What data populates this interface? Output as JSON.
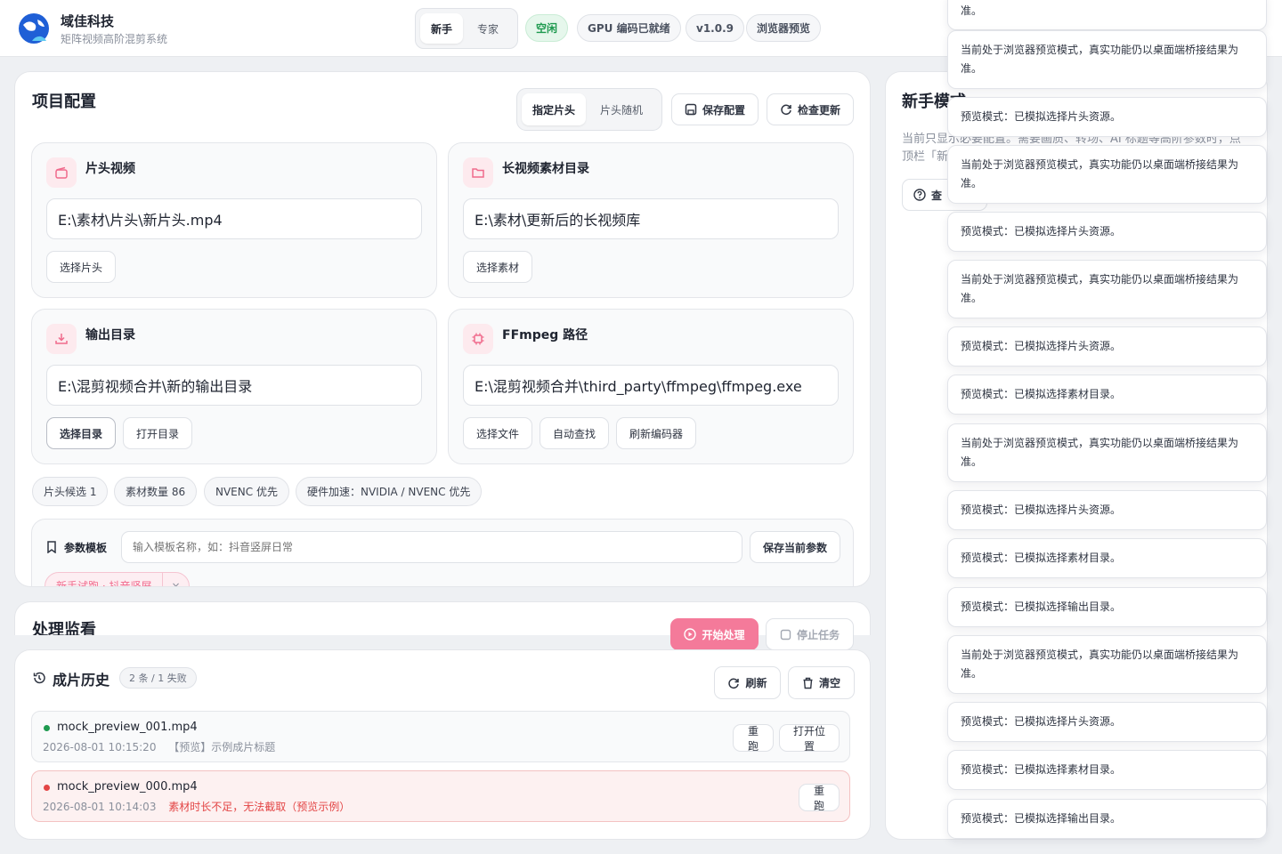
{
  "app": {
    "name": "域佳科技",
    "subtitle": "矩阵视频高阶混剪系统"
  },
  "mode_toggle": {
    "novice": "新手",
    "expert": "专家",
    "active": "novice"
  },
  "status": {
    "idle": "空闲",
    "gpu": "GPU 编码已就绪",
    "version": "v1.0.9",
    "preview": "浏览器预览"
  },
  "project": {
    "title": "项目配置",
    "head_mode": {
      "fixed": "指定片头",
      "random": "片头随机"
    },
    "save_config": "保存配置",
    "check_update": "检查更新",
    "intro_card": {
      "title": "片头视频",
      "value": "E:\\素材\\片头\\新片头.mp4",
      "button": "选择片头"
    },
    "material_card": {
      "title": "长视频素材目录",
      "value": "E:\\素材\\更新后的长视频库",
      "button": "选择素材"
    },
    "output_card": {
      "title": "输出目录",
      "value": "E:\\混剪视频合并\\新的输出目录",
      "btn_select": "选择目录",
      "btn_open": "打开目录"
    },
    "ffmpeg_card": {
      "title": "FFmpeg 路径",
      "value": "E:\\混剪视频合并\\third_party\\ffmpeg\\ffmpeg.exe",
      "btn_file": "选择文件",
      "btn_auto": "自动查找",
      "btn_refresh": "刷新编码器"
    },
    "chips": [
      "片头候选 1",
      "素材数量 86",
      "NVENC 优先",
      "硬件加速：NVIDIA / NVENC 优先"
    ],
    "template": {
      "label": "参数模板",
      "placeholder": "输入模板名称，如：抖音竖屏日常",
      "save": "保存当前参数",
      "tag": "新手试跑 · 抖音竖屏"
    }
  },
  "monitor": {
    "title": "处理监看",
    "start": "开始处理",
    "stop": "停止任务"
  },
  "history": {
    "title": "成片历史",
    "badge": "2 条 / 1 失败",
    "refresh": "刷新",
    "clear": "清空",
    "items": [
      {
        "name": "mock_preview_001.mp4",
        "time": "2026-08-01 10:15:20",
        "note": "【预览】示例成片标题",
        "status": "ok",
        "rerun": "重跑",
        "open": "打开位置"
      },
      {
        "name": "mock_preview_000.mp4",
        "time": "2026-08-01 10:14:03",
        "note": "素材时长不足，无法截取（预览示例）",
        "status": "error",
        "rerun": "重跑"
      }
    ]
  },
  "guide": {
    "title": "新手模式",
    "text1": "当前只显示必要配置。需要画质、转场、AI 标题等高阶参数时，点",
    "text2": "顶栏「新",
    "btn": "查"
  },
  "toasts": [
    "准。",
    "当前处于浏览器预览模式，真实功能仍以桌面端桥接结果为准。",
    "预览模式：已模拟选择片头资源。",
    "当前处于浏览器预览模式，真实功能仍以桌面端桥接结果为准。",
    "预览模式：已模拟选择片头资源。",
    "当前处于浏览器预览模式，真实功能仍以桌面端桥接结果为准。",
    "预览模式：已模拟选择片头资源。",
    "预览模式：已模拟选择素材目录。",
    "当前处于浏览器预览模式，真实功能仍以桌面端桥接结果为准。",
    "预览模式：已模拟选择片头资源。",
    "预览模式：已模拟选择素材目录。",
    "预览模式：已模拟选择输出目录。",
    "当前处于浏览器预览模式，真实功能仍以桌面端桥接结果为准。",
    "预览模式：已模拟选择片头资源。",
    "预览模式：已模拟选择素材目录。",
    "预览模式：已模拟选择输出目录。"
  ],
  "colors": {
    "accent": "#f06a8c",
    "success": "#1e9a4f",
    "error": "#e34545"
  }
}
